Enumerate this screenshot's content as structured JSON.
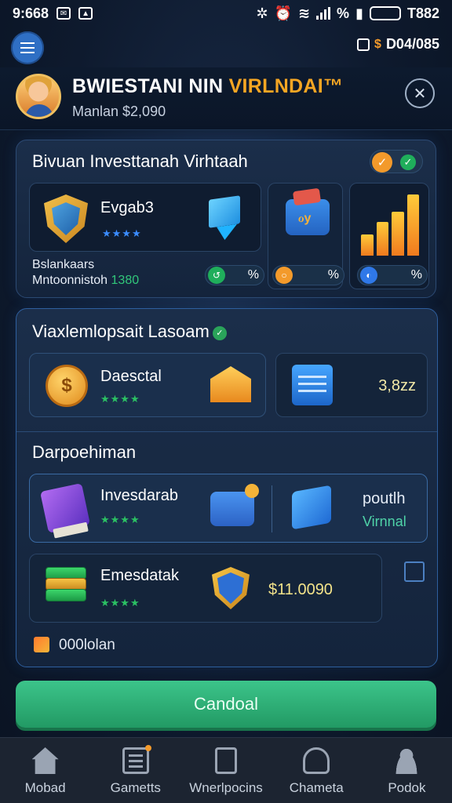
{
  "status_bar": {
    "time": "9:668",
    "right_text": "T882",
    "battery_label": "",
    "signal": "%"
  },
  "top_bar": {
    "balance_text": "D04/085"
  },
  "header": {
    "title_main": "BWIESTANI NIN ",
    "title_accent": "VIRLNDAI™",
    "subtitle": "Manlan $2,090"
  },
  "panel1": {
    "title": "Bivuan Investtanah Virhtaah",
    "card_shield": {
      "name": "Evgab3",
      "stars": "★★★★"
    },
    "footer_line1": "Bslankaars",
    "footer_line2_prefix": "Mntoonnistoh ",
    "footer_line2_value": "1380",
    "pills": [
      {
        "icon": "↺",
        "text": "%",
        "color": "#1fae5b"
      },
      {
        "icon": "○",
        "text": "%",
        "color": "#f39a2b"
      },
      {
        "icon": "◐",
        "text": "%",
        "color": "#2f78e8"
      }
    ],
    "bar_heights": [
      0.35,
      0.55,
      0.72,
      1.0
    ]
  },
  "panel2": {
    "title": "Viaxlemlopsait Lasoam",
    "card_coin": {
      "name": "Daesctal",
      "stars": "★★★★"
    },
    "card_calendar_value": "3,8zz",
    "section_title": "Darpoehiman",
    "card_invest": {
      "name": "Invesdarab",
      "stars": "★★★★",
      "right_line1": "poutlh",
      "right_line2": "Virnnal"
    },
    "card_emb": {
      "name": "Emesdatak",
      "stars": "★★★★",
      "value": "$11.0090"
    },
    "footer_text": "000lolan"
  },
  "cta": {
    "label": "Candoal"
  },
  "bottom_nav": [
    {
      "label": "Mobad",
      "icon": "home-icon"
    },
    {
      "label": "Gametts",
      "icon": "list-icon"
    },
    {
      "label": "Wnerlpocins",
      "icon": "document-icon"
    },
    {
      "label": "Chameta",
      "icon": "cart-icon"
    },
    {
      "label": "Podok",
      "icon": "user-icon"
    }
  ]
}
